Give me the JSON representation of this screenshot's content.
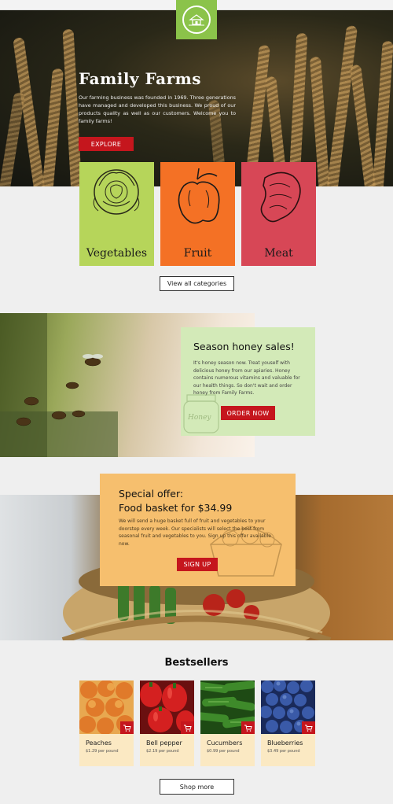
{
  "hero": {
    "title": "Family Farms",
    "text": "Our farming business was founded in 1969. Three generations have managed and developed this business. We proud of our products quality as well as our customers. Welcome you to family farms!",
    "button": "EXPLORE"
  },
  "categories": [
    {
      "label": "Vegetables",
      "color": "#b6d55a"
    },
    {
      "label": "Fruit",
      "color": "#f47125"
    },
    {
      "label": "Meat",
      "color": "#d74756"
    }
  ],
  "view_all": "View all categories",
  "honey": {
    "title": "Season honey sales!",
    "text": "It's honey season now. Treat youself with delicious honey from our apiaries. Honey contains numerous vitamins and valuable for our health things. So don't wait and order honey from Family Farms.",
    "button": "ORDER NOW",
    "jar_label": "Honey"
  },
  "offer": {
    "title_line1": "Special offer:",
    "title_line2": "Food basket for $34.99",
    "text": "We will send a huge basket full of fruit and vegetables to your doorstep every week. Our specialists will select the best from seasonal fruit and vegetables to you. Sign up this offer available now.",
    "button": "SIGN UP"
  },
  "bestsellers": {
    "title": "Bestsellers",
    "products": [
      {
        "name": "Peaches",
        "price": "$1.29 per pound"
      },
      {
        "name": "Bell pepper",
        "price": "$2.19 per pound"
      },
      {
        "name": "Cucumbers",
        "price": "$0.99 per pound"
      },
      {
        "name": "Blueberries",
        "price": "$3.49 per pound"
      }
    ]
  },
  "shop_more": "Shop more",
  "colors": {
    "accent_red": "#c5161d",
    "logo_green": "#8bc34a",
    "honey_card": "#d3eab8",
    "offer_card": "#f6bf6e",
    "product_card": "#fbe9c3"
  },
  "icons": {
    "logo": "farm-logo-icon",
    "cart": "cart-icon"
  }
}
